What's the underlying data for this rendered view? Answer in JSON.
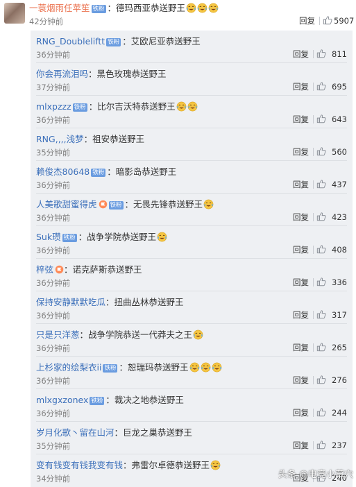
{
  "main_comment": {
    "user": "一蓑烟雨任苹笙",
    "badge": "铁粉",
    "text": "德玛西亚恭送野王",
    "emojis": 3,
    "time": "42分钟前",
    "reply_label": "回复",
    "likes": "5907"
  },
  "replies": [
    {
      "user": "RNG_Doubleliftt",
      "badge": "铁粉",
      "flag": false,
      "text": "艾欧尼亚恭送野王",
      "emojis": 0,
      "time": "36分钟前",
      "reply_label": "回复",
      "likes": "811"
    },
    {
      "user": "你会再流泪吗",
      "badge": "",
      "flag": false,
      "text": "黑色玫瑰恭送野王",
      "emojis": 0,
      "time": "37分钟前",
      "reply_label": "回复",
      "likes": "695"
    },
    {
      "user": "mlxpzzz",
      "badge": "铁粉",
      "flag": false,
      "text": "比尔吉沃特恭送野王",
      "emojis": 2,
      "time": "36分钟前",
      "reply_label": "回复",
      "likes": "643"
    },
    {
      "user": "RNG,,,,浅梦",
      "badge": "",
      "flag": false,
      "text": "祖安恭送野王",
      "emojis": 0,
      "time": "35分钟前",
      "reply_label": "回复",
      "likes": "560"
    },
    {
      "user": "赖俊杰80648",
      "badge": "铁粉",
      "flag": false,
      "text": "暗影岛恭送野王",
      "emojis": 0,
      "time": "36分钟前",
      "reply_label": "回复",
      "likes": "437"
    },
    {
      "user": "人美歌甜蜜得虎",
      "badge": "铁粉",
      "flag": true,
      "text": "无畏先锋恭送野王",
      "emojis": 1,
      "time": "36分钟前",
      "reply_label": "回复",
      "likes": "423"
    },
    {
      "user": "Suk瓒",
      "badge": "铁粉",
      "flag": false,
      "text": "战争学院恭送野王",
      "emojis": 1,
      "time": "36分钟前",
      "reply_label": "回复",
      "likes": "408"
    },
    {
      "user": "梓弦",
      "badge": "",
      "flag": true,
      "text": "诺克萨斯恭送野王",
      "emojis": 0,
      "time": "36分钟前",
      "reply_label": "回复",
      "likes": "336"
    },
    {
      "user": "保持安静默默吃瓜",
      "badge": "",
      "flag": false,
      "text": "扭曲丛林恭送野王",
      "emojis": 0,
      "time": "36分钟前",
      "reply_label": "回复",
      "likes": "317"
    },
    {
      "user": "只是只洋葱",
      "badge": "",
      "flag": false,
      "text": "战争学院恭送一代莽夫之王",
      "emojis": 1,
      "time": "36分钟前",
      "reply_label": "回复",
      "likes": "265"
    },
    {
      "user": "上杉家的绘梨衣ii",
      "badge": "铁粉",
      "flag": false,
      "text": "恕瑞玛恭送野王",
      "emojis": 3,
      "time": "36分钟前",
      "reply_label": "回复",
      "likes": "276"
    },
    {
      "user": "mlxgxzonex",
      "badge": "铁粉",
      "flag": false,
      "text": "裁决之地恭送野王",
      "emojis": 0,
      "time": "36分钟前",
      "reply_label": "回复",
      "likes": "244"
    },
    {
      "user": "岁月化歌丶留在山河",
      "badge": "",
      "flag": false,
      "text": "巨龙之巢恭送野王",
      "emojis": 0,
      "time": "35分钟前",
      "reply_label": "回复",
      "likes": "237"
    },
    {
      "user": "变有钱变有钱我变有钱",
      "badge": "",
      "flag": false,
      "text": "弗雷尔卓德恭送野王",
      "emojis": 1,
      "time": "34分钟前",
      "reply_label": "回复",
      "likes": "240"
    }
  ],
  "watermark": "头条 @电竞小草穴",
  "colors": {
    "link": "#3b6fba",
    "main_user": "#eb7350",
    "reply_bg": "#eef0f3",
    "badge": "#6a9ce0"
  }
}
